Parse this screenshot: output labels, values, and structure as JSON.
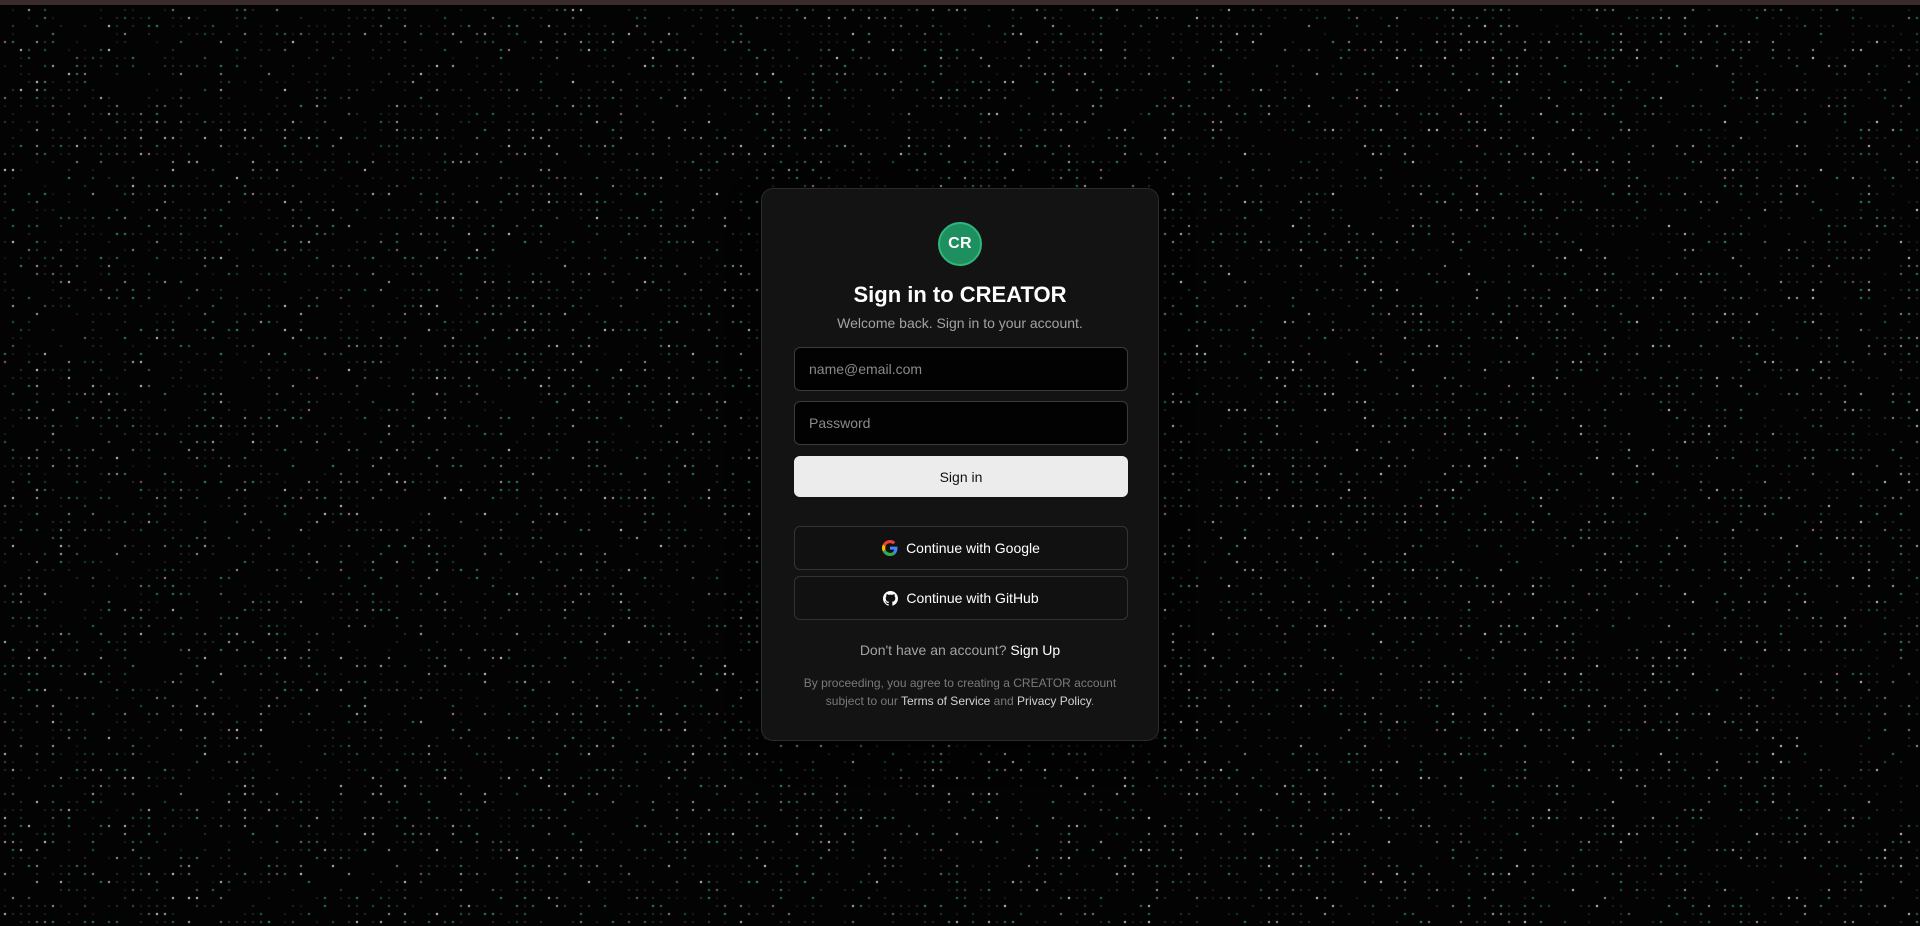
{
  "app": {
    "logo_initials": "CR"
  },
  "signin": {
    "title": "Sign in to CREATOR",
    "subtitle": "Welcome back. Sign in to your account.",
    "email_placeholder": "name@email.com",
    "email_value": "",
    "password_placeholder": "Password",
    "password_value": "",
    "submit_label": "Sign in",
    "google_label": "Continue with Google",
    "github_label": "Continue with GitHub",
    "signup_prompt": "Don't have an account?",
    "signup_label": "Sign Up",
    "legal_prefix": "By proceeding, you agree to creating a CREATOR account subject to our",
    "terms_label": "Terms of Service",
    "legal_and": "and",
    "privacy_label": "Privacy Policy",
    "legal_suffix": "."
  },
  "icons": {
    "logo": "logo-badge",
    "google": "google-icon",
    "github": "github-icon"
  },
  "colors": {
    "background": "#030303",
    "card": "#131313",
    "accent": "#1e8f5f",
    "dot_green": "#3fbf8a",
    "dot_white": "#e8e8e8",
    "dot_pink": "#c9a0b0",
    "button_primary": "#ececec"
  }
}
